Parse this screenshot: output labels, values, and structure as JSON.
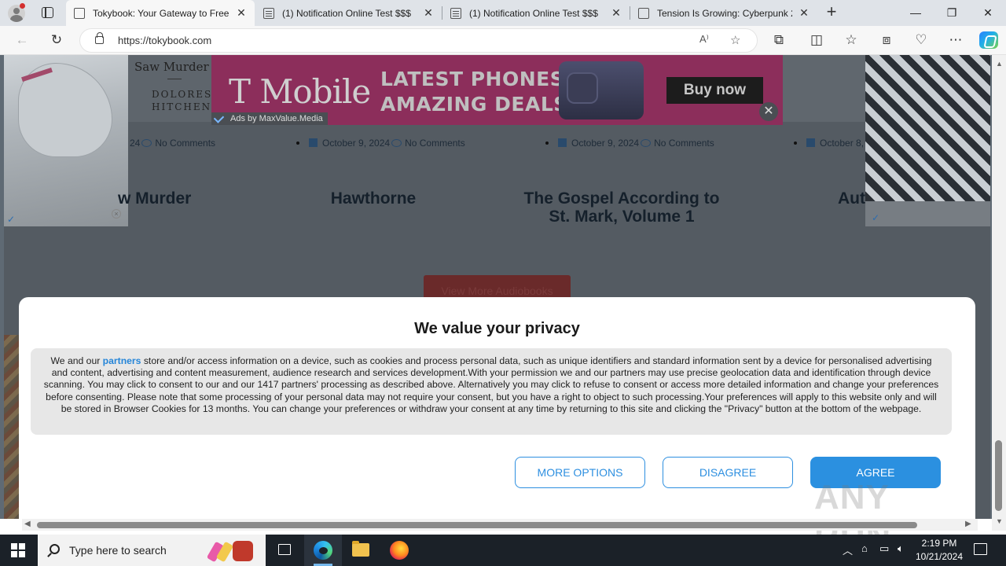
{
  "browser": {
    "tabs": [
      {
        "title": "Tokybook: Your Gateway to Free",
        "active": true
      },
      {
        "title": "(1) Notification Online Test $$$",
        "active": false
      },
      {
        "title": "(1) Notification Online Test $$$",
        "active": false
      },
      {
        "title": "Tension Is Growing: Cyberpunk 2",
        "active": false
      }
    ],
    "url": "https://tokybook.com"
  },
  "page": {
    "ad": {
      "brand": "T Mobile",
      "headline_line1": "LATEST PHONES",
      "headline_line2": "AMAZING DEALS",
      "cta": "Buy now",
      "credit": "Ads by MaxValue.Media",
      "close": "✕"
    },
    "book_cover_left": {
      "title": "Saw Murder",
      "author_line1": "DOLORES",
      "author_line2": "HITCHENS"
    },
    "meta_items": [
      {
        "date": "24",
        "comments": "No Comments"
      },
      {
        "date": "October 9, 2024",
        "comments": "No Comments"
      },
      {
        "date": "October 9, 2024",
        "comments": "No Comments"
      },
      {
        "date": "October 8,",
        "comments": ""
      }
    ],
    "book_titles": {
      "t1": "w Murder",
      "t2": "Hawthorne",
      "t3_line1": "The Gospel According to",
      "t3_line2": "St. Mark, Volume 1",
      "t4": "Aut"
    },
    "view_more": "View More Audiobooks"
  },
  "consent": {
    "title": "We value your privacy",
    "body_prefix": "We and our ",
    "partners_link": "partners",
    "body_rest": " store and/or access information on a device, such as cookies and process personal data, such as unique identifiers and standard information sent by a device for personalised advertising and content, advertising and content measurement, audience research and services development.With your permission we and our partners may use precise geolocation data and identification through device scanning. You may click to consent to our and our 1417 partners' processing as described above. Alternatively you may click to refuse to consent or access more detailed information and change your preferences before consenting. Please note that some processing of your personal data may not require your consent, but you have a right to object to such processing.Your preferences will apply to this website only and will be stored in Browser Cookies for 13 months. You can change your preferences or withdraw your consent at any time by returning to this site and clicking the \"Privacy\" button at the bottom of the webpage.",
    "buttons": {
      "more": "MORE OPTIONS",
      "disagree": "DISAGREE",
      "agree": "AGREE"
    }
  },
  "watermark": "ANY RUN",
  "taskbar": {
    "search_placeholder": "Type here to search",
    "time": "2:19 PM",
    "date": "10/21/2024"
  },
  "colors": {
    "accent": "#2b90e0",
    "ad_bg": "#e20074",
    "link": "#2585d8"
  }
}
